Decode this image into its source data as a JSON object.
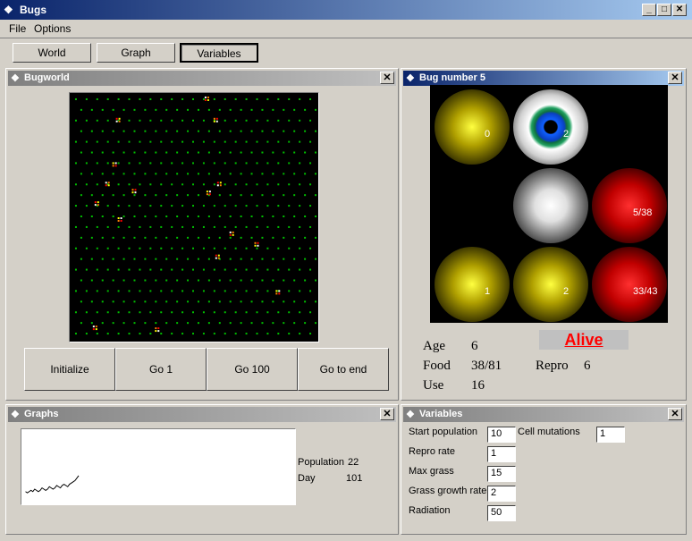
{
  "window": {
    "title": "Bugs"
  },
  "menu": [
    "File",
    "Options"
  ],
  "toolbar": {
    "world": "World",
    "graph": "Graph",
    "variables": "Variables"
  },
  "bugworld": {
    "title": "Bugworld",
    "buttons": {
      "initialize": "Initialize",
      "go1": "Go 1",
      "go100": "Go 100",
      "goend": "Go to end"
    }
  },
  "bug": {
    "title": "Bug number 5",
    "cells": [
      {
        "kind": "food",
        "label": "0"
      },
      {
        "kind": "eye",
        "label": "2"
      },
      {
        "kind": "empty",
        "label": ""
      },
      {
        "kind": "empty",
        "label": ""
      },
      {
        "kind": "white",
        "label": ""
      },
      {
        "kind": "red",
        "label": "5/38"
      },
      {
        "kind": "food",
        "label": "1"
      },
      {
        "kind": "food",
        "label": "2"
      },
      {
        "kind": "red",
        "label": "33/43"
      }
    ],
    "status": "Alive",
    "age_label": "Age",
    "age": "6",
    "food_label": "Food",
    "food": "38/81",
    "repro_label": "Repro",
    "repro": "6",
    "use_label": "Use",
    "use": "16"
  },
  "graphs": {
    "title": "Graphs",
    "population_label": "Population",
    "population": "22",
    "day_label": "Day",
    "day": "101",
    "series": [
      9,
      8,
      9,
      10,
      9,
      11,
      10,
      9,
      10,
      12,
      11,
      10,
      11,
      13,
      12,
      11,
      12,
      14,
      13,
      12,
      14,
      15,
      14,
      13,
      15,
      16,
      17,
      18,
      20,
      22
    ]
  },
  "variables": {
    "title": "Variables",
    "start_population_label": "Start population",
    "start_population": "10",
    "cell_mutations_label": "Cell mutations",
    "cell_mutations": "1",
    "repro_rate_label": "Repro rate",
    "repro_rate": "1",
    "max_grass_label": "Max grass",
    "max_grass": "15",
    "grass_growth_rate_label": "Grass growth rate",
    "grass_growth_rate": "2",
    "radiation_label": "Radiation",
    "radiation": "50"
  },
  "colors": {
    "accent": "#0a246a",
    "alive": "#ff0000",
    "grass": "#00c000",
    "food": "#ffff00",
    "danger": "#ff0000"
  }
}
